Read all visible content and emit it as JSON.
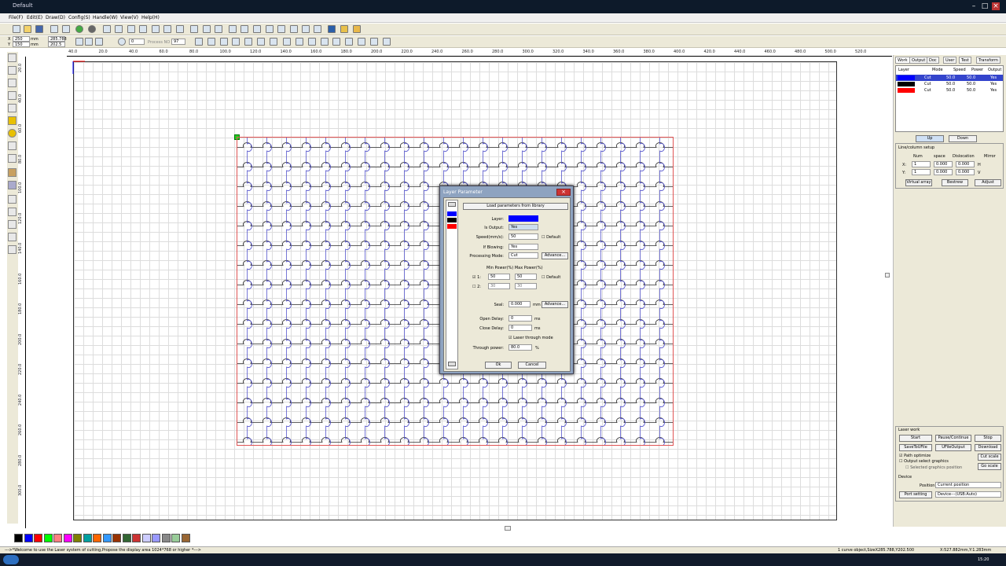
{
  "window": {
    "title": "Default"
  },
  "menu": [
    "File(F)",
    "Edit(E)",
    "Draw(D)",
    "Config(S)",
    "Handle(W)",
    "View(V)",
    "Help(H)"
  ],
  "toolbar2": {
    "coord_x": "250",
    "coord_y": "150",
    "unit_x": "mm",
    "unit_y": "mm",
    "size_w": "285.788",
    "size_h": "202.5",
    "angle": "0",
    "process_label": "Process NO",
    "process_no": "97"
  },
  "ruler_h": [
    "40.0",
    "20.0",
    "40.0",
    "60.0",
    "80.0",
    "100.0",
    "120.0",
    "140.0",
    "160.0",
    "180.0",
    "200.0",
    "220.0",
    "240.0",
    "260.0",
    "280.0",
    "300.0",
    "320.0",
    "340.0",
    "360.0",
    "380.0",
    "400.0",
    "420.0",
    "440.0",
    "460.0",
    "480.0",
    "500.0",
    "520.0"
  ],
  "ruler_v": [
    "20.0",
    "40.0",
    "60.0",
    "80.0",
    "100.0",
    "120.0",
    "140.0",
    "160.0",
    "180.0",
    "200.0",
    "220.0",
    "240.0",
    "260.0",
    "280.0",
    "300.0"
  ],
  "right_panel": {
    "tabs": [
      "Work",
      "Output",
      "Doc",
      "User",
      "Test",
      "Transform"
    ],
    "layer_headers": [
      "Layer",
      "Mode",
      "Speed",
      "Power",
      "Output"
    ],
    "layers": [
      {
        "color": "#0000ff",
        "mode": "Cut",
        "speed": "50.0",
        "power": "50.0",
        "output": "Yes",
        "selected": true
      },
      {
        "color": "#000000",
        "mode": "Cut",
        "speed": "50.0",
        "power": "50.0",
        "output": "Yes",
        "selected": false
      },
      {
        "color": "#ff0000",
        "mode": "Cut",
        "speed": "50.0",
        "power": "50.0",
        "output": "Yes",
        "selected": false
      }
    ],
    "up_label": "Up",
    "down_label": "Down",
    "array": {
      "title": "Line/column setup",
      "headers": [
        "Num",
        "space",
        "Dislocation",
        "Mirror"
      ],
      "x_label": "X:",
      "x_num": "1",
      "x_space": "0.000",
      "x_disl": "0.000",
      "x_h": "H",
      "y_label": "Y:",
      "y_num": "1",
      "y_space": "0.000",
      "y_disl": "0.000",
      "y_v": "V",
      "virtual_array": "Virtual array",
      "bestrew": "Bestrew",
      "adjust": "Adjust"
    },
    "laser_work": {
      "title": "Laser work",
      "start": "Start",
      "pause": "Pause/Continue",
      "stop": "Stop",
      "savetofile": "SaveToUFile",
      "ufileoutput": "UFileOutput",
      "download": "Download",
      "path_optimize": "Path optimize",
      "output_select": "Output select graphics",
      "selected_pos": "Selected graphics position",
      "cut_scale": "Cut scale",
      "go_scale": "Go scale",
      "device_label": "Device",
      "position_label": "Position:",
      "position_value": "Current position",
      "port_setting": "Port setting",
      "port_value": "Device---(USB:Auto)"
    }
  },
  "dialog": {
    "title": "Layer Parameter",
    "load_library": "Load parameters from library",
    "layer_label": "Layer:",
    "layer_color": "#0000ff",
    "is_output_label": "Is Output:",
    "is_output_value": "Yes",
    "speed_label": "Speed(mm/s):",
    "speed_value": "50",
    "default_label": "Default",
    "blowing_label": "If Blowing:",
    "blowing_value": "Yes",
    "mode_label": "Processing Mode:",
    "mode_value": "Cut",
    "advance_label": "Advance...",
    "power_header": "Min Power(%) Max Power(%)",
    "p1_label": "1:",
    "p1_min": "50",
    "p1_max": "50",
    "p_default": "Default",
    "p2_label": "2:",
    "p2_min": "30",
    "p2_max": "30",
    "seal_label": "Seal:",
    "seal_value": "0.000",
    "seal_unit": "mm",
    "seal_advance": "Advance...",
    "open_delay_label": "Open Delay:",
    "open_delay_value": "0",
    "open_delay_unit": "ms",
    "close_delay_label": "Close Delay:",
    "close_delay_value": "0",
    "close_delay_unit": "ms",
    "through_mode_label": "Laser through mode",
    "through_power_label": "Through power:",
    "through_power_value": "80.0",
    "through_power_unit": "%",
    "ok": "Ok",
    "cancel": "Cancel",
    "layer_colors": [
      "#0000ff",
      "#000000",
      "#ff0000"
    ]
  },
  "palette": [
    "#000000",
    "#0000ff",
    "#ff0000",
    "#00ff00",
    "#ff8080",
    "#ff00ff",
    "#808000",
    "#00a0a0",
    "#ff6600",
    "#3399ff",
    "#993300",
    "#336633",
    "#cc3333",
    "#ccccff",
    "#9999ff",
    "#888888",
    "#99cc99",
    "#996633"
  ],
  "status": {
    "message": "--->*Welcome to use the Laser system of cutting,Propose the display area 1024*768 or higher *--->",
    "selection": "1 curve object,SizeX285.788,Y202.500",
    "cursor": "X:527.882mm,Y:1.283mm"
  },
  "taskbar": {
    "clock": "15:20"
  }
}
